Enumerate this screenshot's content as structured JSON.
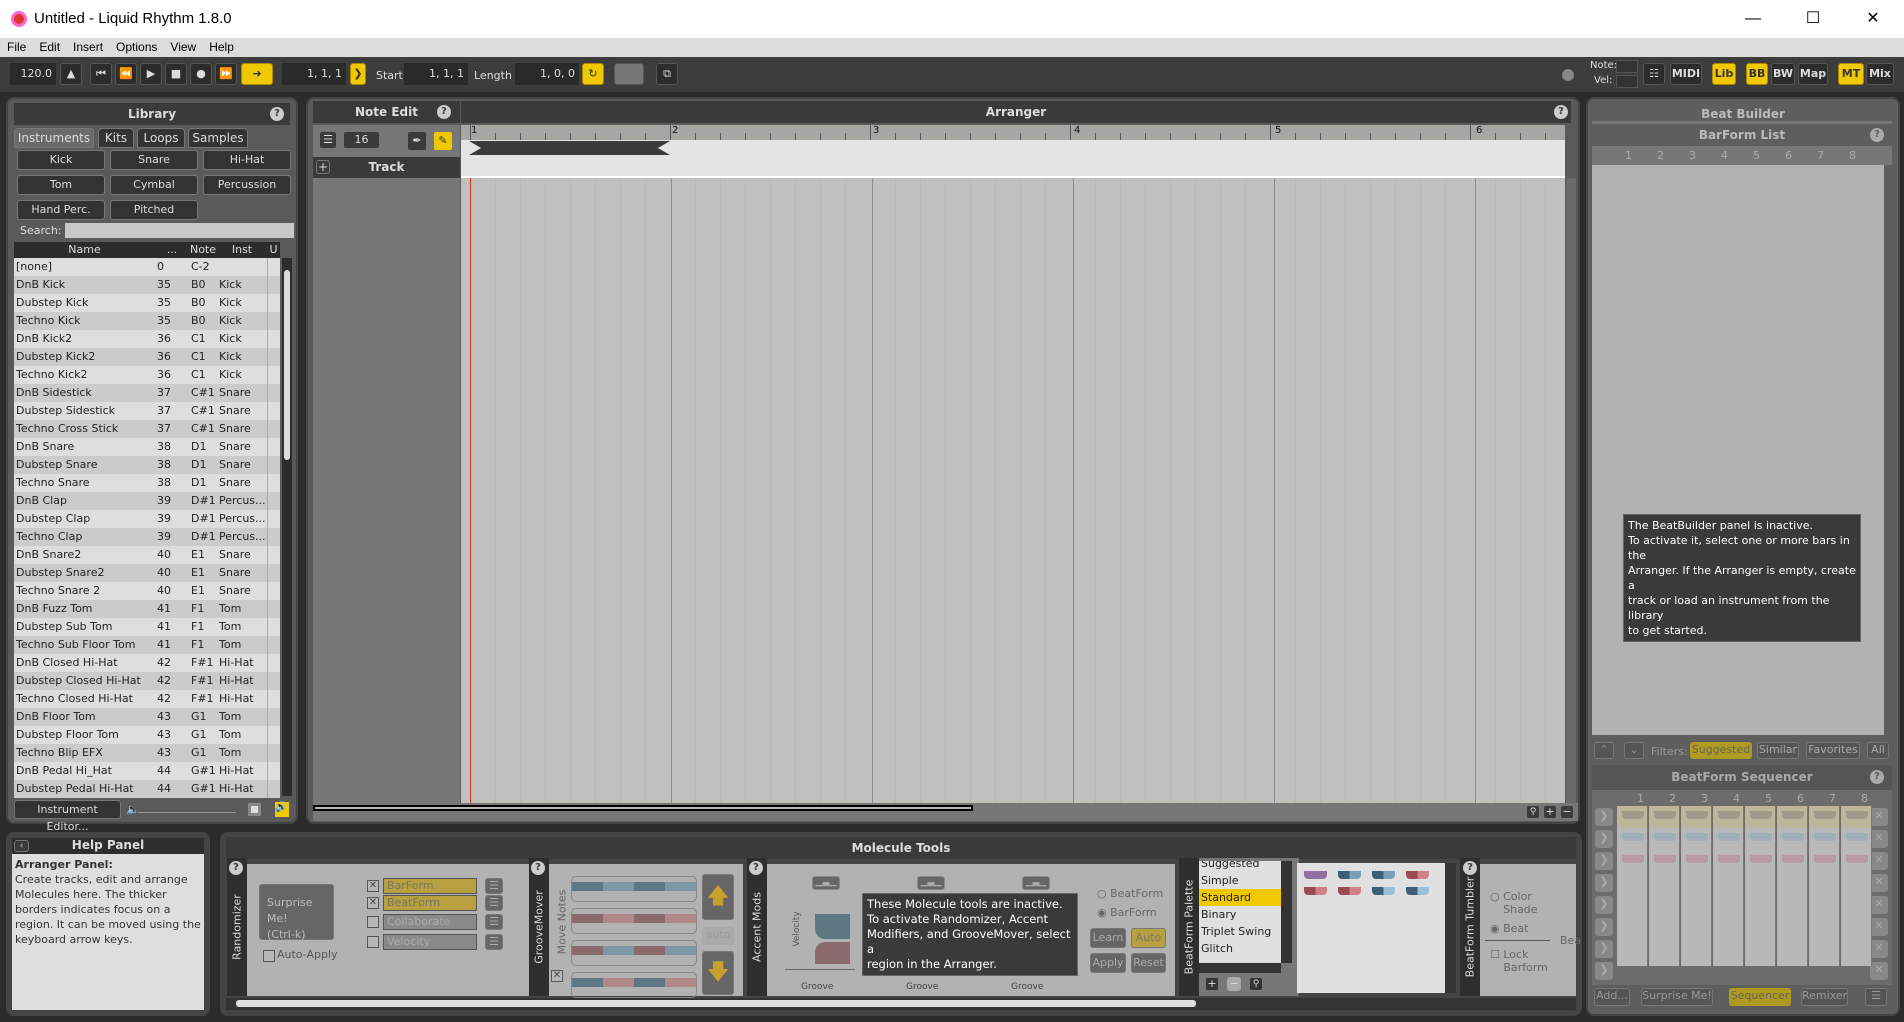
{
  "window": {
    "title": "Untitled - Liquid Rhythm 1.8.0"
  },
  "menu": [
    "File",
    "Edit",
    "Insert",
    "Options",
    "View",
    "Help"
  ],
  "toolbar": {
    "tempo": "120.0",
    "position": "1, 1, 1",
    "start_label": "Start",
    "start": "1, 1, 1",
    "length_label": "Length",
    "length": "1, 0, 0",
    "note_label": "Note:",
    "vel_label": "Vel:",
    "buttons": {
      "midi": "MIDI",
      "lib": "Lib",
      "bb": "BB",
      "bw": "BW",
      "map": "Map",
      "mt": "MT",
      "mix": "Mix"
    }
  },
  "library": {
    "title": "Library",
    "tabs": [
      "Instruments",
      "Kits",
      "Loops",
      "Samples"
    ],
    "categories": [
      "Kick",
      "Snare",
      "Hi-Hat",
      "Tom",
      "Cymbal",
      "Percussion",
      "Hand Perc.",
      "Pitched"
    ],
    "search_label": "Search:",
    "search_value": "",
    "columns": [
      "Name",
      "...",
      "Note",
      "Inst",
      "U"
    ],
    "rows": [
      [
        "[none]",
        "0",
        "C-2",
        ""
      ],
      [
        "DnB Kick",
        "35",
        "B0",
        "Kick"
      ],
      [
        "Dubstep Kick",
        "35",
        "B0",
        "Kick"
      ],
      [
        "Techno Kick",
        "35",
        "B0",
        "Kick"
      ],
      [
        "DnB Kick2",
        "36",
        "C1",
        "Kick"
      ],
      [
        "Dubstep Kick2",
        "36",
        "C1",
        "Kick"
      ],
      [
        "Techno Kick2",
        "36",
        "C1",
        "Kick"
      ],
      [
        "DnB Sidestick",
        "37",
        "C#1",
        "Snare"
      ],
      [
        "Dubstep Sidestick",
        "37",
        "C#1",
        "Snare"
      ],
      [
        "Techno Cross Stick",
        "37",
        "C#1",
        "Snare"
      ],
      [
        "DnB Snare",
        "38",
        "D1",
        "Snare"
      ],
      [
        "Dubstep Snare",
        "38",
        "D1",
        "Snare"
      ],
      [
        "Techno Snare",
        "38",
        "D1",
        "Snare"
      ],
      [
        "DnB Clap",
        "39",
        "D#1",
        "Percus..."
      ],
      [
        "Dubstep Clap",
        "39",
        "D#1",
        "Percus..."
      ],
      [
        "Techno Clap",
        "39",
        "D#1",
        "Percus..."
      ],
      [
        "DnB Snare2",
        "40",
        "E1",
        "Snare"
      ],
      [
        "Dubstep Snare2",
        "40",
        "E1",
        "Snare"
      ],
      [
        "Techno Snare 2",
        "40",
        "E1",
        "Snare"
      ],
      [
        "DnB Fuzz Tom",
        "41",
        "F1",
        "Tom"
      ],
      [
        "Dubstep Sub Tom",
        "41",
        "F1",
        "Tom"
      ],
      [
        "Techno Sub Floor Tom",
        "41",
        "F1",
        "Tom"
      ],
      [
        "DnB Closed Hi-Hat",
        "42",
        "F#1",
        "Hi-Hat"
      ],
      [
        "Dubstep Closed Hi-Hat",
        "42",
        "F#1",
        "Hi-Hat"
      ],
      [
        "Techno Closed Hi-Hat",
        "42",
        "F#1",
        "Hi-Hat"
      ],
      [
        "DnB Floor Tom",
        "43",
        "G1",
        "Tom"
      ],
      [
        "Dubstep Floor Tom",
        "43",
        "G1",
        "Tom"
      ],
      [
        "Techno Blip EFX",
        "43",
        "G1",
        "Tom"
      ],
      [
        "DnB Pedal Hi_Hat",
        "44",
        "G#1",
        "Hi-Hat"
      ],
      [
        "Dubstep Pedal Hi-Hat",
        "44",
        "G#1",
        "Hi-Hat"
      ]
    ],
    "instrument_editor": "Instrument Editor..."
  },
  "note_edit": {
    "title": "Note Edit",
    "grid_value": "16",
    "track_label": "Track"
  },
  "arranger": {
    "title": "Arranger",
    "bars": [
      "1",
      "2",
      "3",
      "4",
      "5",
      "6"
    ]
  },
  "beat_builder": {
    "title": "Beat Builder",
    "barform_list": "BarForm List",
    "columns": [
      "1",
      "2",
      "3",
      "4",
      "5",
      "6",
      "7",
      "8"
    ],
    "inactive_msg": [
      "The BeatBuilder panel is inactive.",
      "To activate it, select one or more bars in the",
      "Arranger. If the Arranger is empty, create a",
      "track or load an instrument from the library",
      "to get started."
    ],
    "filters_label": "Filters:",
    "filters": [
      "Suggested",
      "Similar",
      "Favorites",
      "All"
    ],
    "active_filter": "Suggested",
    "sequencer_title": "BeatForm Sequencer",
    "buttons": [
      "Add...",
      "Surprise Me!",
      "Sequencer",
      "Remixer"
    ],
    "active_mode": "Sequencer"
  },
  "help_panel": {
    "title": "Help Panel",
    "heading": "Arranger Panel:",
    "body": "Create tracks, edit and arrange Molecules here. The thicker borders indicates focus on a region. It can be moved using the keyboard arrow keys."
  },
  "molecule_tools": {
    "title": "Molecule Tools",
    "randomizer": {
      "label": "Randomizer",
      "surprise": "Surprise Me!",
      "shortcut": "(Ctrl-k)",
      "auto_apply": "Auto-Apply",
      "options": [
        {
          "label": "BarForm",
          "checked": true
        },
        {
          "label": "BeatForm",
          "checked": true
        },
        {
          "label": "Collaborate",
          "checked": false
        },
        {
          "label": "Velocity",
          "checked": false
        }
      ]
    },
    "groovemover": {
      "label": "GrooveMover",
      "move_notes": "Move Notes",
      "auto": "auto"
    },
    "accent_mods": {
      "label": "Accent Mods",
      "velocity": "Velocity",
      "groove": "Groove",
      "beatform": "BeatForm",
      "barform": "BarForm",
      "selected_radio": "BarForm",
      "learn": "Learn",
      "auto": "Auto",
      "apply": "Apply",
      "reset": "Reset",
      "inactive_msg": [
        "These Molecule tools are inactive.",
        "To activate Randomizer, Accent",
        "Modifiers, and GrooveMover, select a",
        "region in the Arranger."
      ]
    },
    "palette": {
      "label": "BeatForm Palette",
      "items": [
        "Suggested",
        "Simple",
        "Standard",
        "Binary",
        "Triplet Swing",
        "Glitch"
      ],
      "selected": "Standard"
    },
    "tumbler": {
      "label": "BeatForm Tumbler",
      "color_shade": "Color Shade",
      "beat": "Beat",
      "lock_barform": "Lock Barform",
      "selected": "Beat",
      "beat_cut": "Bea"
    }
  },
  "colors": {
    "accent": "#f0c800",
    "panel": "#5a5a5a",
    "dark": "#3a3a3a",
    "grid": "#c0c1bc",
    "playhead": "#e03020"
  }
}
